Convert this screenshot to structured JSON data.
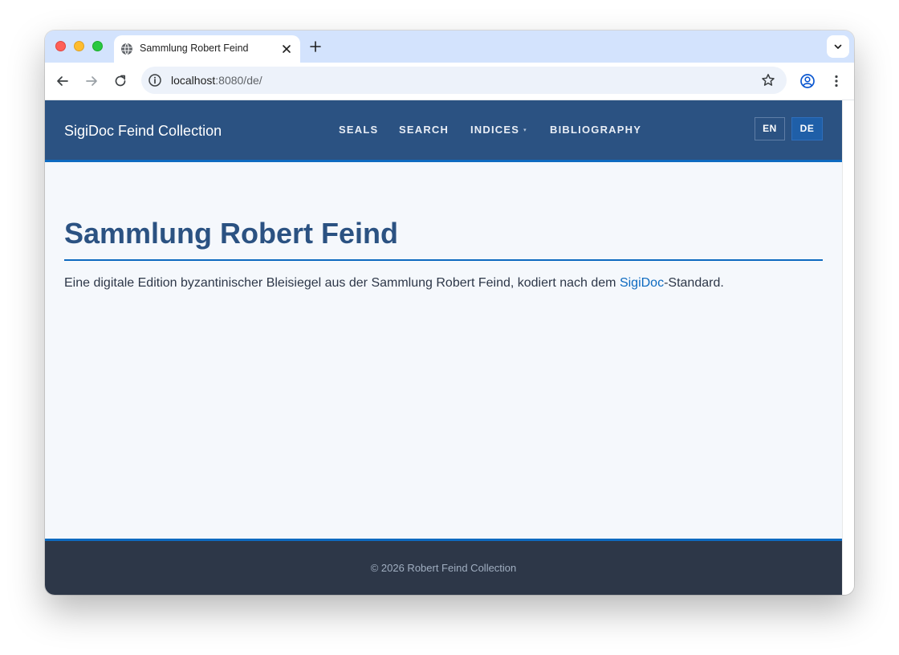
{
  "browser": {
    "tab_title": "Sammlung Robert Feind",
    "url_host": "localhost",
    "url_path": ":8080/de/"
  },
  "site": {
    "brand": "SigiDoc Feind Collection",
    "nav": [
      {
        "label": "SEALS"
      },
      {
        "label": "SEARCH"
      },
      {
        "label": "INDICES",
        "caret": "▾"
      },
      {
        "label": "BIBLIOGRAPHY"
      }
    ],
    "languages": [
      {
        "label": "EN",
        "active": false
      },
      {
        "label": "DE",
        "active": true
      }
    ]
  },
  "main": {
    "title": "Sammlung Robert Feind",
    "intro_before": "Eine digitale Edition byzantinischer Bleisiegel aus der Sammlung Robert Feind, kodiert nach dem ",
    "intro_link": "SigiDoc",
    "intro_after": "-Standard."
  },
  "footer": {
    "text": "© 2026 Robert Feind Collection"
  },
  "colors": {
    "header_bg": "#2b5282",
    "accent": "#0d6ac0",
    "page_bg": "#f5f8fc",
    "footer_bg": "#2d3748"
  }
}
